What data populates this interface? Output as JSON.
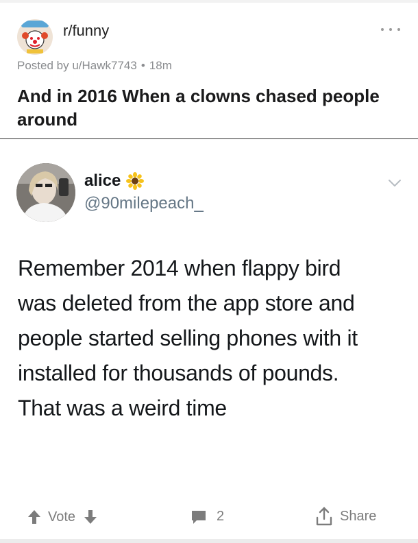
{
  "post": {
    "subreddit": "r/funny",
    "posted_by": "Posted by u/Hawk7743",
    "separator": "•",
    "age": "18m",
    "title": "And in 2016 When a clowns chased people around",
    "more_icon": "ellipsis-icon"
  },
  "tweet": {
    "name": "alice",
    "name_emoji": "sunflower-icon",
    "handle": "@90milepeach_",
    "lines": [
      "Remember 2014 when flappy bird",
      "was deleted from the app store and",
      "people started selling phones with it",
      "installed for thousands of pounds.",
      "That was a weird time"
    ],
    "menu_icon": "chevron-down-icon"
  },
  "actions": {
    "vote_label": "Vote",
    "comment_count": "2",
    "share_label": "Share"
  },
  "colors": {
    "meta_text": "#8a8c8f",
    "action_text": "#7c7c7c",
    "handle_text": "#657786"
  }
}
